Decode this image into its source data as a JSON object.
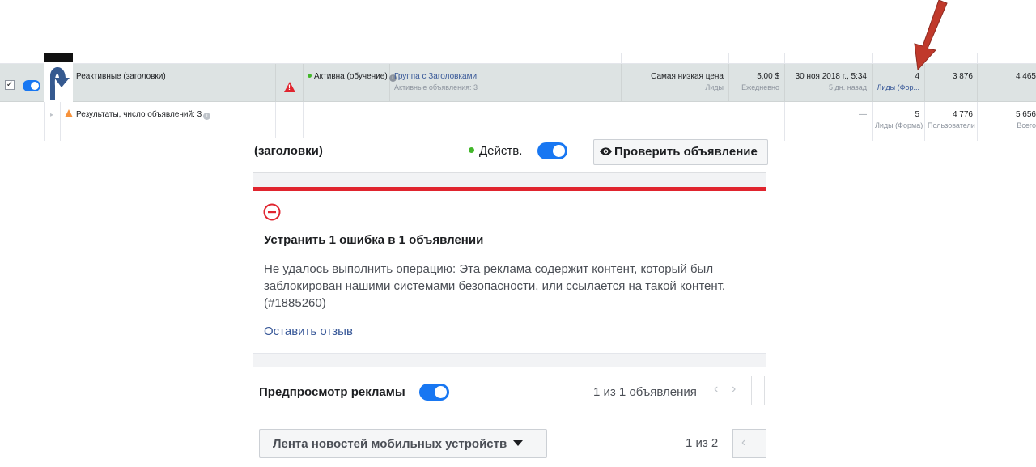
{
  "table": {
    "main_row": {
      "checkbox": "✓",
      "ad_name": "Реактивные (заголовки)",
      "delivery": "Активна (обучение)",
      "info": "i",
      "ad_set_link": "Группа с Заголовками",
      "ad_set_sub": "Активные объявления: 3",
      "bid_strategy": "Самая низкая цена",
      "bid_sub": "Лиды",
      "budget": "5,00 $",
      "budget_sub": "Ежедневно",
      "last_edit": "30 ноя 2018 г., 5:34",
      "last_edit_sub": "5 дн. назад",
      "results": "4",
      "results_sub": "Лиды (Фор...",
      "reach": "3 876",
      "impressions": "4 465"
    },
    "summary_row": {
      "label": "Результаты, число объявлений: 3",
      "dash": "—",
      "results": "5",
      "results_sub": "Лиды (Форма)",
      "reach": "4 776",
      "reach_sub": "Пользователи",
      "impressions": "5 656",
      "impressions_sub": "Всего"
    }
  },
  "panel": {
    "title": "(заголовки)",
    "status": "Действ.",
    "review_button": "Проверить объявление",
    "error_title": "Устранить 1 ошибка в 1 объявлении",
    "error_body": "Не удалось выполнить операцию: Эта реклама содержит контент, который был заблокирован нашими системами безопасности, или ссылается на такой контент. (#1885260)",
    "feedback_link": "Оставить отзыв",
    "preview_label": "Предпросмотр рекламы",
    "preview_count": "1 из 1 объявления",
    "chev_left": "‹",
    "chev_right": "›",
    "placement": "Лента новостей мобильных устройств",
    "page_count": "1 из 2"
  },
  "colors": {
    "accent": "#1877f2",
    "error": "#e0242e",
    "link": "#385898",
    "status_green": "#42b72a",
    "warning": "#f7923b",
    "arrow": "#c0392b"
  },
  "icons": [
    "eye-icon",
    "error-circle-icon",
    "warning-icon",
    "info-icon",
    "chevron-left-icon",
    "chevron-right-icon",
    "caret-down-icon",
    "red-arrow"
  ]
}
